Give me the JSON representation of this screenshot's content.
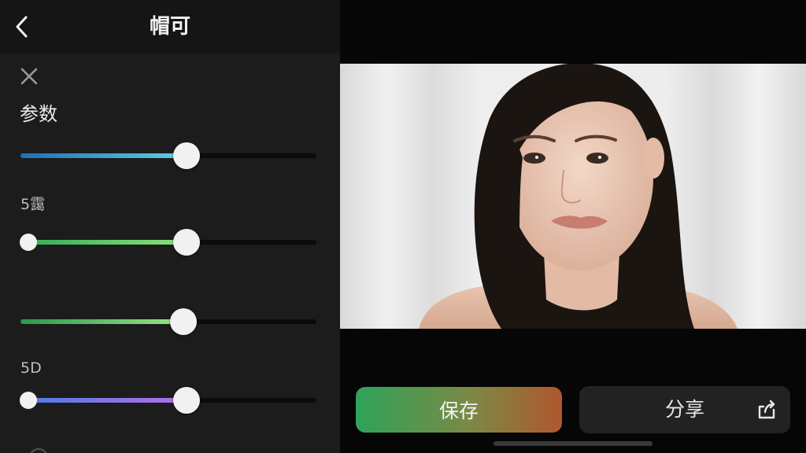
{
  "header": {
    "title": "帽可",
    "back_icon": "chevron-left-icon"
  },
  "panel": {
    "close_icon": "close-icon",
    "section_title": "参数"
  },
  "sliders": [
    {
      "label": "",
      "value": 0.56,
      "colors": [
        "#1f6fb0",
        "#5fd0e6"
      ],
      "has_start_knob": false
    },
    {
      "label": "5靄",
      "value": 0.56,
      "colors": [
        "#2fae58",
        "#8ee07a"
      ],
      "has_start_knob": true
    },
    {
      "label": "",
      "value": 0.55,
      "colors": [
        "#2a9a4a",
        "#9ce58a"
      ],
      "has_start_knob": false
    },
    {
      "label": "5D",
      "value": 0.56,
      "colors": [
        "#4b7be6",
        "#b56ee8"
      ],
      "has_start_knob": true
    }
  ],
  "actions": {
    "save_label": "保存",
    "share_label": "分享",
    "share_icon": "share-icon"
  },
  "colors": {
    "panel_bg": "#1c1c1c",
    "topbar_bg": "#151515",
    "page_bg": "#060606",
    "share_bg": "#222222"
  }
}
